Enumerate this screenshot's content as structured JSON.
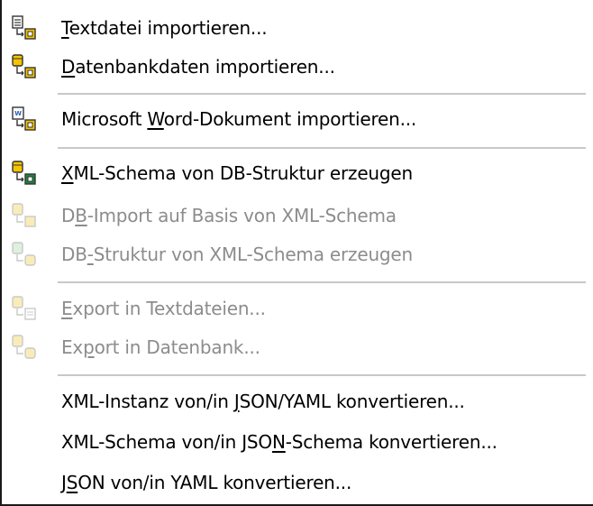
{
  "menu": {
    "items": [
      {
        "id": "textdatei",
        "parts": [
          "",
          "T",
          "extdatei importieren..."
        ],
        "enabled": true,
        "icon": "text-file-import-icon"
      },
      {
        "id": "datenbank",
        "parts": [
          "",
          "D",
          "atenbankdaten importieren..."
        ],
        "enabled": true,
        "icon": "database-import-icon"
      },
      {
        "id": "word",
        "parts": [
          "Microsoft ",
          "W",
          "ord-Dokument importieren..."
        ],
        "enabled": true,
        "icon": "word-document-import-icon"
      },
      {
        "id": "xmlschema-db",
        "parts": [
          "",
          "X",
          "ML-Schema von DB-Struktur erzeugen"
        ],
        "enabled": true,
        "icon": "schema-from-db-icon"
      },
      {
        "id": "db-import",
        "parts": [
          "D",
          "B",
          "-Import auf Basis von XML-Schema"
        ],
        "enabled": false,
        "icon": "db-import-schema-icon"
      },
      {
        "id": "db-struktur",
        "parts": [
          "DB",
          "-",
          "Struktur von XML-Schema erzeugen"
        ],
        "enabled": false,
        "icon": "db-structure-from-schema-icon"
      },
      {
        "id": "export-text",
        "parts": [
          "",
          "E",
          "xport in Textdateien..."
        ],
        "enabled": false,
        "icon": "export-text-icon"
      },
      {
        "id": "export-db",
        "parts": [
          "Ex",
          "p",
          "ort in Datenbank..."
        ],
        "enabled": false,
        "icon": "export-database-icon"
      },
      {
        "id": "xml-json-yaml",
        "parts": [
          "XML-Instanz von/in ",
          "J",
          "SON/YAML konvertieren..."
        ],
        "enabled": true,
        "icon": ""
      },
      {
        "id": "xmlschema-json",
        "parts": [
          "XML-Schema von/in JSO",
          "N",
          "-Schema konvertieren..."
        ],
        "enabled": true,
        "icon": ""
      },
      {
        "id": "json-yaml",
        "parts": [
          "J",
          "S",
          "ON von/in YAML konvertieren..."
        ],
        "enabled": true,
        "icon": ""
      }
    ]
  },
  "colors": {
    "enabled_text": "#000000",
    "disabled_text": "#8c8c8c",
    "separator": "#c8c8c8",
    "icon_yellow": "#f5c400",
    "icon_green": "#1a8a3a"
  }
}
